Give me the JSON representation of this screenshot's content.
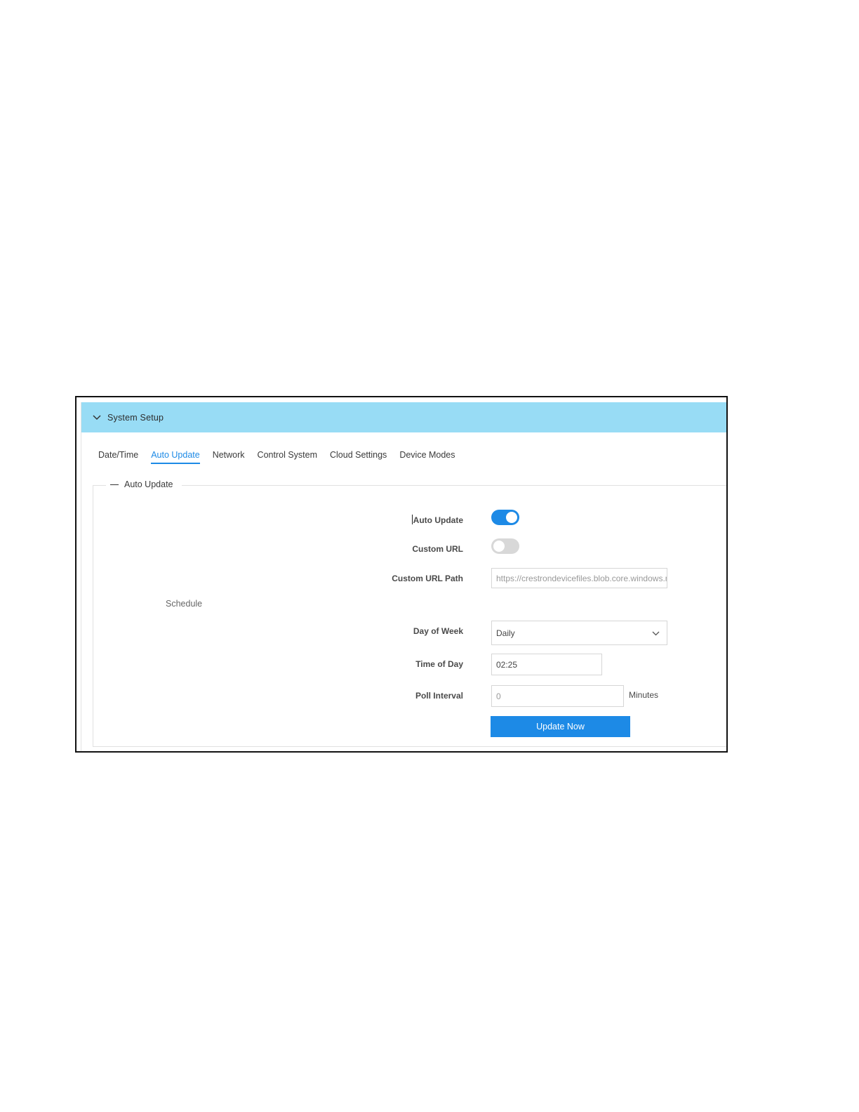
{
  "panel": {
    "title": "System Setup",
    "tabs": [
      {
        "label": "Date/Time",
        "active": false
      },
      {
        "label": "Auto Update",
        "active": true
      },
      {
        "label": "Network",
        "active": false
      },
      {
        "label": "Control System",
        "active": false
      },
      {
        "label": "Cloud Settings",
        "active": false
      },
      {
        "label": "Device Modes",
        "active": false
      }
    ]
  },
  "section": {
    "legend": "Auto Update",
    "schedule_label": "Schedule"
  },
  "form": {
    "auto_update": {
      "label": "Auto Update",
      "enabled": true
    },
    "custom_url": {
      "label": "Custom URL",
      "enabled": false
    },
    "custom_url_path": {
      "label": "Custom URL Path",
      "value": "https://crestrondevicefiles.blob.core.windows.net"
    },
    "day_of_week": {
      "label": "Day of Week",
      "value": "Daily"
    },
    "time_of_day": {
      "label": "Time of Day",
      "value": "02:25"
    },
    "poll_interval": {
      "label": "Poll Interval",
      "placeholder": "0",
      "units": "Minutes"
    },
    "update_now_label": "Update Now"
  },
  "colors": {
    "header_bg": "#98dcf5",
    "accent": "#1d8ae6"
  },
  "icons": {
    "collapse": "chevron-down-icon",
    "select": "chevron-down-icon"
  }
}
